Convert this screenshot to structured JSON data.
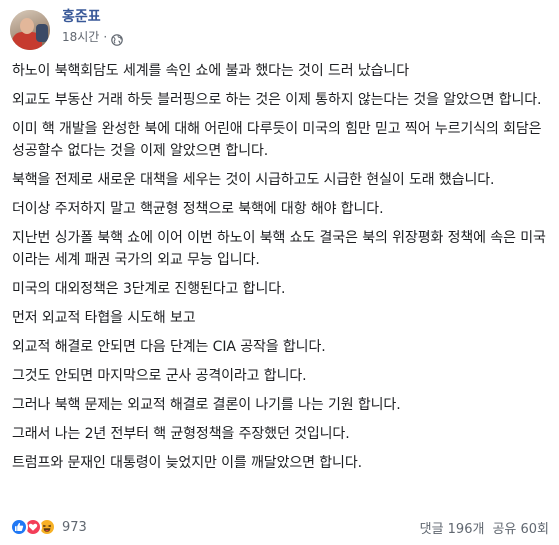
{
  "post": {
    "author": "홍준표",
    "time": "18시간",
    "separator": "·",
    "icons": {
      "avatar": "profile-photo",
      "privacy": "globe-icon"
    },
    "paragraphs": [
      "하노이 북핵회담도 세계를 속인 쇼에 불과 했다는 것이 드러 났습니다",
      "외교도 부동산 거래 하듯 블러핑으로 하는 것은 이제 통하지 않는다는 것을 알았으면 합니다.",
      "이미 핵 개발을 완성한 북에 대해 어린애 다루듯이 미국의 힘만 믿고 찍어 누르기식의 회담은 성공할수 없다는 것을 이제 알았으면 합니다.",
      "북핵을 전제로 새로운 대책을 세우는 것이 시급하고도 시급한 현실이 도래 했습니다.",
      "더이상 주저하지 말고 핵균형 정책으로 북핵에 대항 해야 합니다.",
      "지난번 싱가폴 북핵 쇼에 이어 이번 하노이 북핵 쇼도 결국은 북의 위장평화 정책에 속은 미국이라는 세계 패권 국가의 외교 무능 입니다.",
      "미국의 대외정책은 3단계로 진행된다고 합니다.",
      "먼저 외교적 타협을 시도해 보고",
      "외교적 해결로 안되면 다음 단계는 CIA 공작을 합니다.",
      "그것도 안되면 마지막으로 군사 공격이라고 합니다.",
      "그러나 북핵 문제는 외교적 해결로 결론이 나기를 나는 기원 합니다.",
      "그래서 나는 2년 전부터 핵 균형정책을 주장했던 것입니다.",
      "트럼프와 문재인 대통령이 늦었지만 이를 깨달았으면 합니다."
    ]
  },
  "footer": {
    "reaction_icons": [
      "like-icon",
      "love-icon",
      "haha-icon"
    ],
    "reaction_count": "973",
    "comments": "댓글 196개",
    "shares": "공유 60회"
  },
  "colors": {
    "author": "#385898",
    "like": "#2078f4",
    "love": "#f33e58",
    "haha": "#f7b125",
    "meta_text": "#616770"
  }
}
